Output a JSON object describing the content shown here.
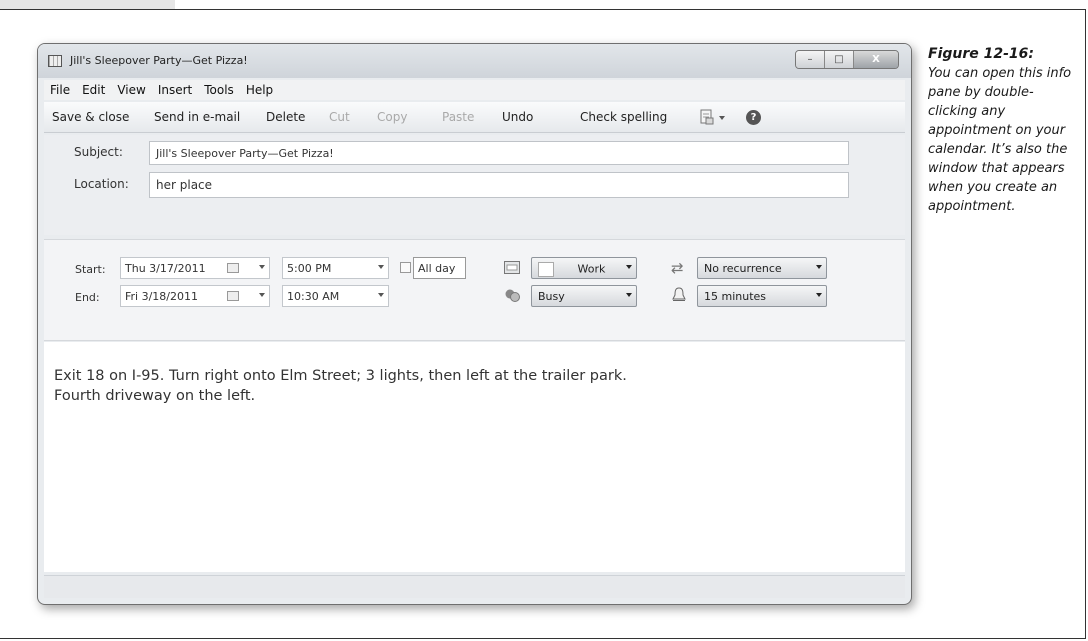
{
  "window": {
    "title": "Jill's Sleepover Party—Get Pizza!",
    "controls": {
      "minimize": "–",
      "maximize": "□",
      "close": "X"
    }
  },
  "menu": [
    "File",
    "Edit",
    "View",
    "Insert",
    "Tools",
    "Help"
  ],
  "toolbar": {
    "save_close": "Save & close",
    "send_email": "Send in e-mail",
    "delete": "Delete",
    "cut": "Cut",
    "copy": "Copy",
    "paste": "Paste",
    "undo": "Undo",
    "check_spelling": "Check spelling",
    "help": "?"
  },
  "fields": {
    "subject_label": "Subject:",
    "subject_value": "Jill's Sleepover Party—Get Pizza!",
    "location_label": "Location:",
    "location_value": "her place"
  },
  "schedule": {
    "start_label": "Start:",
    "start_date": "Thu 3/17/2011",
    "start_time": "5:00 PM",
    "end_label": "End:",
    "end_date": "Fri 3/18/2011",
    "end_time": "10:30 AM",
    "all_day_label": "All day",
    "calendar_value": "Work",
    "status_value": "Busy",
    "recurrence_value": "No recurrence",
    "reminder_value": "15 minutes"
  },
  "body": {
    "line1": "Exit 18 on I-95. Turn right onto Elm Street; 3 lights, then left at the trailer park.",
    "line2": "Fourth driveway on the left."
  },
  "caption": {
    "title": "Figure 12-16:",
    "text": "You can open this info pane by double-clicking any appointment on your calendar. It’s also the window that appears when you create an appointment."
  },
  "icons": [
    "calendar-icon",
    "print-icon",
    "help-icon",
    "calendar-picker-icon",
    "category-icon",
    "status-icon",
    "recurrence-icon",
    "bell-icon"
  ]
}
